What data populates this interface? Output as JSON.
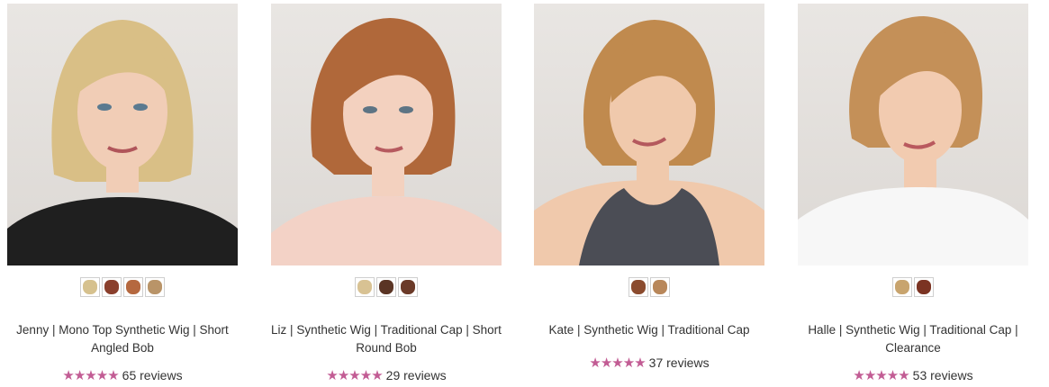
{
  "products": [
    {
      "name": "Jenny | Mono Top Synthetic Wig | Short Angled Bob",
      "reviews": "65 reviews",
      "stars": "★★★★★",
      "rating": 5,
      "hair_color": "#d9bf86",
      "top_color": "#1f1f1f",
      "swatch_colors": [
        "#d6c18e",
        "#8a3f2c",
        "#b5683f",
        "#b99468"
      ]
    },
    {
      "name": "Liz | Synthetic Wig | Traditional Cap | Short Round Bob",
      "reviews": "29 reviews",
      "stars": "★★★★★",
      "rating": 5,
      "hair_color": "#b0683a",
      "top_color": "#f3d2c6",
      "swatch_colors": [
        "#d8c293",
        "#5a3424",
        "#6b3a28"
      ]
    },
    {
      "name": "Kate | Synthetic Wig | Traditional Cap",
      "reviews": "37 reviews",
      "stars": "★★★★★",
      "rating": 5,
      "hair_color": "#c08a4e",
      "top_color": "#4b4d55",
      "swatch_colors": [
        "#8b4b2e",
        "#b8875a"
      ]
    },
    {
      "name": "Halle | Synthetic Wig | Traditional Cap | Clearance",
      "reviews": "53 reviews",
      "stars": "★★★★★",
      "rating": 5,
      "hair_color": "#c49058",
      "top_color": "#f7f7f7",
      "swatch_colors": [
        "#c8a46e",
        "#7b3322"
      ]
    }
  ]
}
